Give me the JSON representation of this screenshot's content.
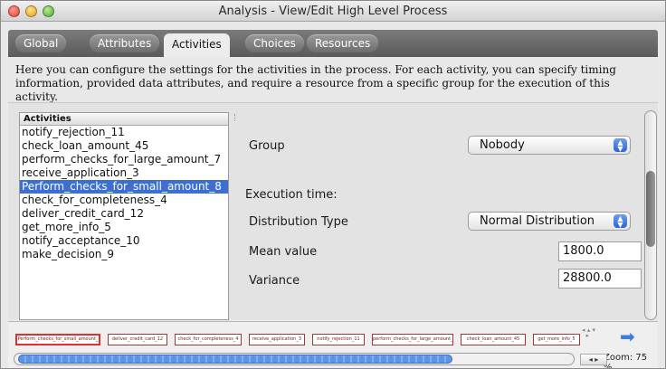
{
  "window": {
    "title": "Analysis - View/Edit High Level Process"
  },
  "tabs": [
    {
      "label": "Global"
    },
    {
      "label": "Attributes"
    },
    {
      "label": "Activities"
    },
    {
      "label": "Choices"
    },
    {
      "label": "Resources"
    }
  ],
  "active_tab": "Activities",
  "description": "Here you can configure the settings for the activities in the process. For each activity, you can specify timing information, provided data attributes, and require a resource from a specific group for the execution of this activity.",
  "activities": {
    "header": "Activities",
    "items": [
      "notify_rejection_11",
      "check_loan_amount_45",
      "perform_checks_for_large_amount_7",
      "receive_application_3",
      "Perform_checks_for_small_amount_8",
      "check_for_completeness_4",
      "deliver_credit_card_12",
      "get_more_info_5",
      "notify_acceptance_10",
      "make_decision_9"
    ],
    "selected_index": 4
  },
  "form": {
    "group_label": "Group",
    "group_value": "Nobody",
    "execution_time_label": "Execution time:",
    "distribution_label": "Distribution Type",
    "distribution_value": "Normal Distribution",
    "mean_label": "Mean value",
    "mean_value": "1800.0",
    "variance_label": "Variance",
    "variance_value": "28800.0"
  },
  "overview": {
    "items": [
      "Perform_checks_for_small_amount_",
      "deliver_credit_card_12",
      "check_for_completeness_4",
      "receive_application_3",
      "notify_rejection_11",
      "perform_checks_for_large_amount_",
      "check_loan_amount_45",
      "get_more_info_5"
    ],
    "selected_index": 0,
    "zoom_label": "Zoom: 75 %"
  },
  "colors": {
    "selection": "#3d6fd0",
    "select_arrow": "#2d64d2",
    "overview_selected_border": "#e03030"
  }
}
